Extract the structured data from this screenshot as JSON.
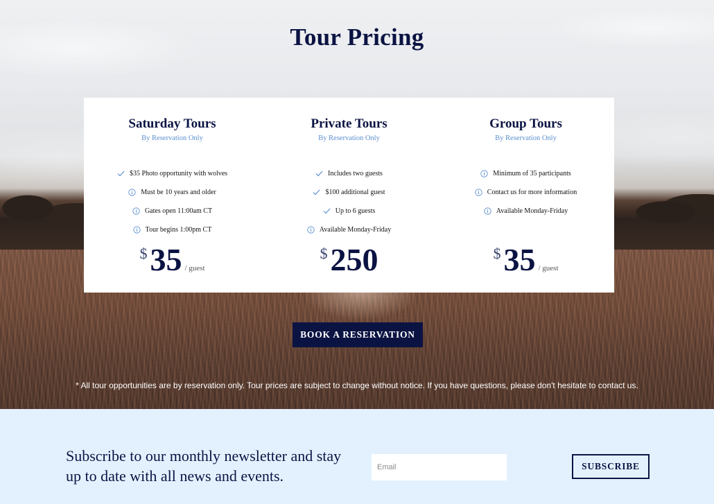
{
  "header": {
    "title": "Tour Pricing"
  },
  "plans": [
    {
      "name": "Saturday Tours",
      "subtitle": "By Reservation Only",
      "features": [
        {
          "icon": "check-icon",
          "text": "$35 Photo opportunity with wolves"
        },
        {
          "icon": "info-icon",
          "text": "Must be 10 years and older"
        },
        {
          "icon": "info-icon",
          "text": "Gates open 11:00am CT"
        },
        {
          "icon": "info-icon",
          "text": "Tour begins 1:00pm CT"
        }
      ],
      "currency": "$",
      "amount": "35",
      "per": "/ guest"
    },
    {
      "name": "Private Tours",
      "subtitle": "By Reservation Only",
      "features": [
        {
          "icon": "check-icon",
          "text": "Includes two guests"
        },
        {
          "icon": "check-icon",
          "text": "$100 additional guest"
        },
        {
          "icon": "check-icon",
          "text": "Up to 6 guests"
        },
        {
          "icon": "info-icon",
          "text": "Available Monday-Friday"
        }
      ],
      "currency": "$",
      "amount": "250",
      "per": ""
    },
    {
      "name": "Group Tours",
      "subtitle": "By Reservation Only",
      "features": [
        {
          "icon": "info-icon",
          "text": "Minimum of 35 participants"
        },
        {
          "icon": "info-icon",
          "text": "Contact us for more information"
        },
        {
          "icon": "info-icon",
          "text": "Available Monday-Friday"
        }
      ],
      "currency": "$",
      "amount": "35",
      "per": "/ guest"
    }
  ],
  "book_button": {
    "label": "BOOK A RESERVATION"
  },
  "disclaimer": "* All tour opportunities are by reservation only. Tour prices are subject to change without notice. If you have questions, please don't hesitate to contact us.",
  "newsletter": {
    "text": "Subscribe to our monthly newsletter and stay up to date with all news and events.",
    "email_placeholder": "Email",
    "email_value": "",
    "subscribe_label": "SUBSCRIBE"
  },
  "colors": {
    "navy": "#0b1342",
    "accent_blue": "#5b8fd0",
    "newsletter_bg": "#e3f1ff"
  }
}
